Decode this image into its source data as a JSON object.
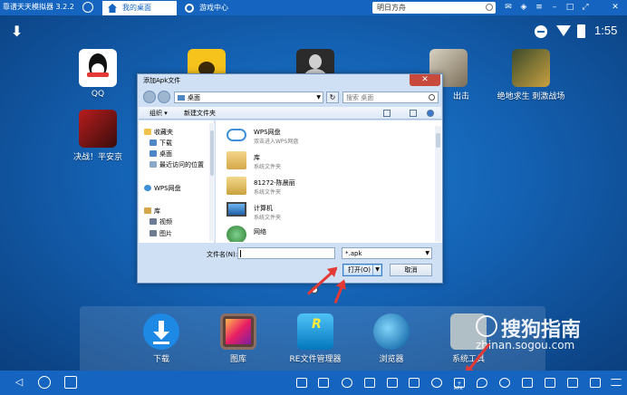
{
  "topbar": {
    "app_title": "靠谱天天模拟器 3.2.2",
    "tabs": [
      {
        "label": "我的桌面",
        "active": true
      },
      {
        "label": "游戏中心",
        "active": false
      }
    ],
    "search_text": "明日方舟"
  },
  "status_bar": {
    "time": "1:55"
  },
  "desktop_apps": [
    {
      "label": "QQ"
    },
    {
      "label": ""
    },
    {
      "label": ""
    },
    {
      "label": "出击"
    },
    {
      "label": "绝地求生 刺激战场"
    },
    {
      "label": "决战！平安京"
    }
  ],
  "dock": {
    "apps": [
      {
        "label": "下载"
      },
      {
        "label": "图库"
      },
      {
        "label": "RE文件管理器"
      },
      {
        "label": "浏览器"
      },
      {
        "label": "系统工具"
      }
    ]
  },
  "dialog": {
    "title": "添加Apk文件",
    "address": "桌面",
    "search_placeholder": "搜索 桌面",
    "organize_label": "组织 ▾",
    "new_folder_label": "新建文件夹",
    "nav_items": [
      {
        "label": "收藏夹",
        "color": "#f2c14e"
      },
      {
        "label": "下载",
        "color": "#4e86c6"
      },
      {
        "label": "桌面",
        "color": "#4e86c6"
      },
      {
        "label": "最近访问的位置",
        "color": "#8aa8c9"
      },
      {
        "label": "WPS网盘",
        "color": "#3f8fd9"
      },
      {
        "label": "库",
        "color": "#d4a84a"
      },
      {
        "label": "视频",
        "color": "#6b7c93"
      },
      {
        "label": "图片",
        "color": "#6b7c93"
      }
    ],
    "files": [
      {
        "name": "WPS网盘",
        "desc": "双击进入WPS网盘"
      },
      {
        "name": "库",
        "desc": "系统文件夹"
      },
      {
        "name": "81272-陈晨丽",
        "desc": "系统文件夹"
      },
      {
        "name": "计算机",
        "desc": "系统文件夹"
      },
      {
        "name": "网络",
        "desc": ""
      }
    ],
    "filename_label": "文件名(N):",
    "filename_value": "",
    "filetype_value": "*.apk",
    "open_label": "打开(O)",
    "cancel_label": "取消"
  },
  "navbar": {
    "apk_label": "APK"
  },
  "watermark": {
    "brand": "搜狗指南",
    "url": "zhinan.sogou.com"
  },
  "colors": {
    "accent": "#1565c0",
    "annotation": "#e53935"
  }
}
